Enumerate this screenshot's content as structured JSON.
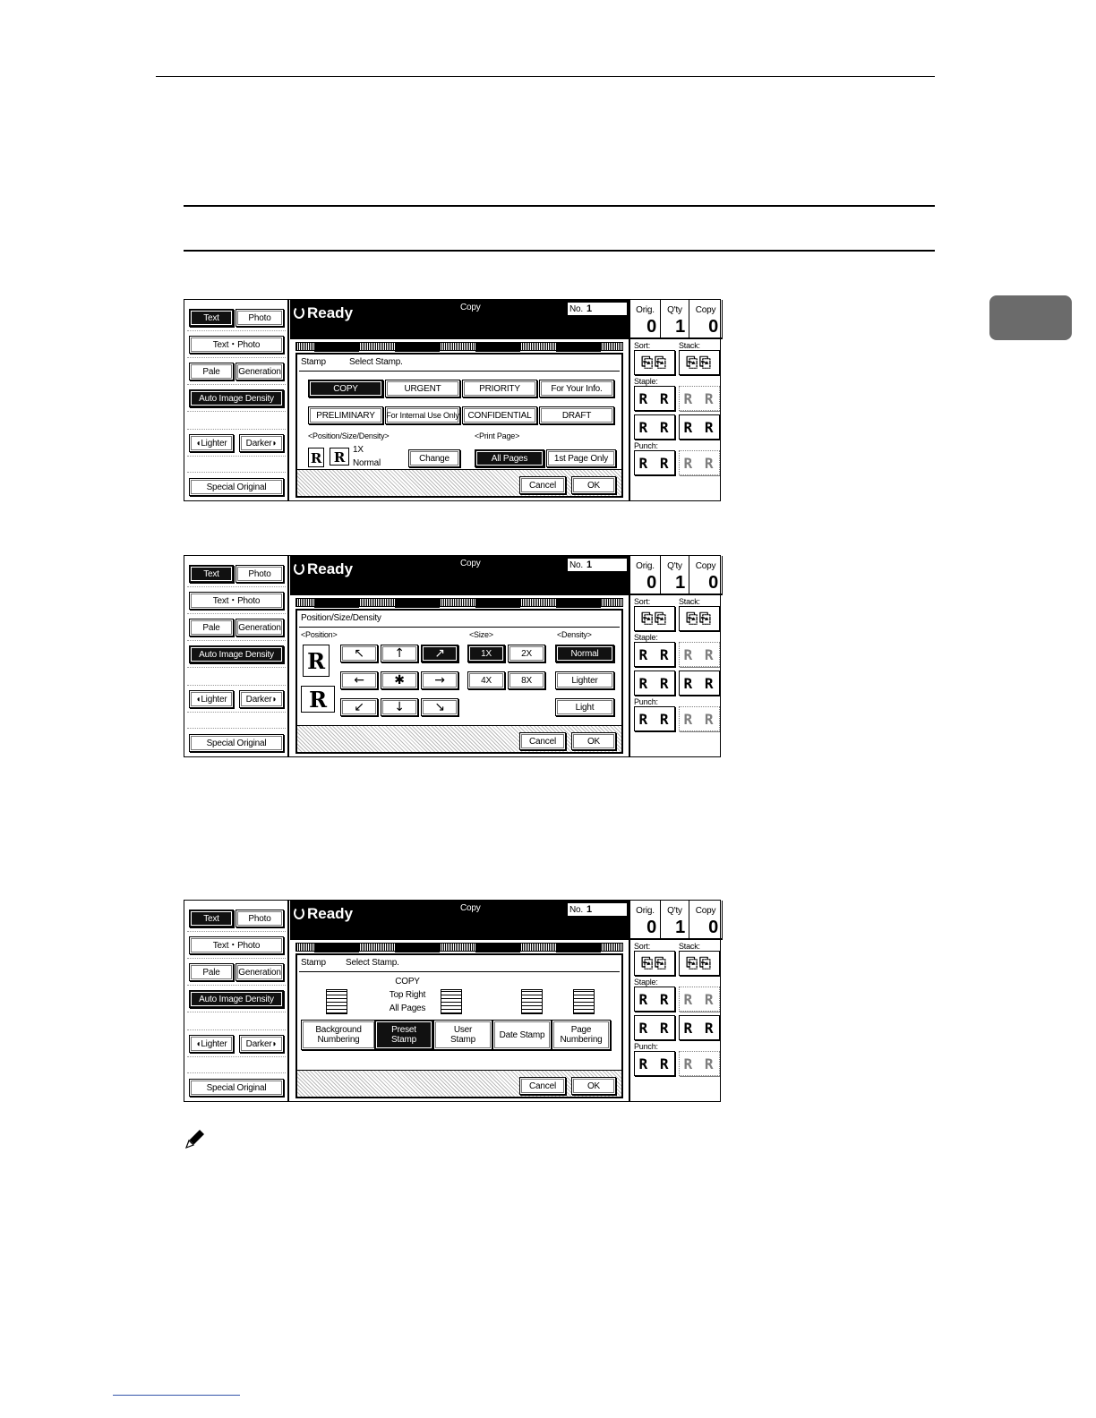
{
  "panel_common": {
    "text": "Text",
    "photo": "Photo",
    "text_photo": "Text・Photo",
    "pale": "Pale",
    "generation": "Generation",
    "auto_image_density": "Auto Image Density",
    "lighter": "◖Lighter",
    "darker": "Darker◗",
    "special_original": "Special Original",
    "ready": "Ready",
    "copy": "Copy",
    "no_label": "No.",
    "no_value": "1",
    "orig_label": "Orig.",
    "orig_value": "0",
    "qty_label": "Q'ty",
    "qty_value": "1",
    "copy_label": "Copy",
    "copy_value": "0",
    "sort": "Sort:",
    "stack": "Stack:",
    "staple": "Staple:",
    "punch": "Punch:",
    "cancel": "Cancel",
    "ok": "OK"
  },
  "panel1": {
    "title": "Stamp",
    "subtitle": "Select Stamp.",
    "stamps_row1": [
      "COPY",
      "URGENT",
      "PRIORITY",
      "For Your Info."
    ],
    "stamps_row2": [
      "PRELIMINARY",
      "For Internal Use Only",
      "CONFIDENTIAL",
      "DRAFT"
    ],
    "position_label": "<Position/Size/Density>",
    "size_value": "1X",
    "density_value": "Normal",
    "change": "Change",
    "print_page_label": "<Print Page>",
    "all_pages": "All Pages",
    "first_page_only": "1st Page Only"
  },
  "panel2": {
    "title": "Position/Size/Density",
    "position_label": "<Position>",
    "size_label": "<Size>",
    "density_label": "<Density>",
    "arrows": [
      "↖",
      "↑",
      "↗",
      "←",
      "✱",
      "→",
      "↙",
      "↓",
      "↘"
    ],
    "sizes": [
      "1X",
      "2X",
      "4X",
      "8X"
    ],
    "densities": [
      "Normal",
      "Lighter",
      "Light"
    ]
  },
  "panel3": {
    "title": "Stamp",
    "subtitle": "Select Stamp.",
    "preset_info": [
      "COPY",
      "Top Right",
      "All Pages"
    ],
    "types": [
      "Background\nNumbering",
      "Preset\nStamp",
      "User\nStamp",
      "Date Stamp",
      "Page\nNumbering"
    ]
  }
}
